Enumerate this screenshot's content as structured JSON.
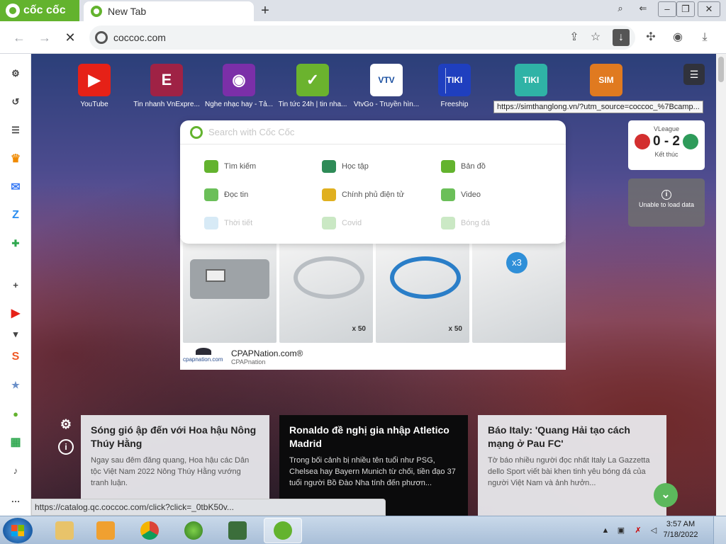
{
  "browser": {
    "brand": "cốc cốc",
    "tab_title": "New Tab",
    "new_tab_symbol": "+",
    "address": "coccoc.com"
  },
  "speed_dial": [
    {
      "label": "YouTube",
      "icon": "youtube-icon",
      "color": "#e62117",
      "glyph": "▶"
    },
    {
      "label": "Tin nhanh VnExpre...",
      "icon": "vnexpress-icon",
      "color": "#9f2245",
      "glyph": "E"
    },
    {
      "label": "Nghe nhạc hay - Tả...",
      "icon": "music-icon",
      "color": "#7b2fa8",
      "glyph": "◉"
    },
    {
      "label": "Tin tức 24h | tin nha...",
      "icon": "news24h-icon",
      "color": "#6bb32e",
      "glyph": "✓"
    },
    {
      "label": "VtvGo - Truyền hìn...",
      "icon": "vtvgo-icon",
      "color": "#ffffff",
      "glyph": "VTV"
    },
    {
      "label": "Freeship",
      "icon": "tiki-icon",
      "color": "#1f3fbf",
      "glyph": "TIKI"
    },
    {
      "label": "",
      "icon": "tiki-book-icon",
      "color": "#2fb3a6",
      "glyph": "TIKI"
    },
    {
      "label": "",
      "icon": "simthanglong-icon",
      "color": "#e07a20",
      "glyph": "SIM"
    }
  ],
  "tooltip": "https://simthanglong.vn/?utm_source=coccoc_%7Bcamp...",
  "search": {
    "placeholder": "Search with Cốc Cốc",
    "services": [
      {
        "label": "Tìm kiếm",
        "icon": "search-service-icon",
        "color": "#63b32e"
      },
      {
        "label": "Học tập",
        "icon": "graduation-cap-icon",
        "color": "#2e8b57"
      },
      {
        "label": "Bản đồ",
        "icon": "map-pin-icon",
        "color": "#63b32e"
      },
      {
        "label": "Đọc tin",
        "icon": "newspaper-icon",
        "color": "#6bbf59"
      },
      {
        "label": "Chính phủ điện tử",
        "icon": "government-icon",
        "color": "#e0b020"
      },
      {
        "label": "Video",
        "icon": "video-icon",
        "color": "#6bbf59"
      },
      {
        "label": "Thời tiết",
        "icon": "weather-icon",
        "color": "#8ec6e8"
      },
      {
        "label": "Covid",
        "icon": "covid-icon",
        "color": "#6bbf59"
      },
      {
        "label": "Bóng đá",
        "icon": "football-icon",
        "color": "#6bbf59"
      }
    ]
  },
  "ad": {
    "title": "CPAPNation.com®",
    "subtitle": "CPAPnation",
    "logo_text": "cpapnation.com",
    "qty_1": "x 50",
    "qty_2": "x 50",
    "badge": "x3"
  },
  "score": {
    "league": "VLeague",
    "score": "0 - 2",
    "status": "Kết thúc"
  },
  "data_card": {
    "message": "Unable to load data"
  },
  "news": [
    {
      "title": "Sóng gió ập đến với Hoa hậu Nông Thúy Hằng",
      "summary": "Ngay sau đêm đăng quang, Hoa hậu các Dân tộc Việt Nam 2022 Nông Thúy Hằng vướng tranh luận."
    },
    {
      "title": "Ronaldo đề nghị gia nhập Atletico Madrid",
      "summary": "Trong bối cảnh bị nhiều tên tuổi như PSG, Chelsea hay Bayern Munich từ chối, tiền đạo 37 tuổi người Bồ Đào Nha tính đến phươn..."
    },
    {
      "title": "Báo Italy: 'Quang Hải tạo cách mạng ở Pau FC'",
      "summary": "Tờ báo nhiều người đọc nhất Italy La Gazzetta dello Sport viết bài khen tinh yêu bóng đá của người Việt Nam và ảnh hưởn..."
    }
  ],
  "status_url": "https://catalog.qc.coccoc.com/click?click=_0tbK50v...",
  "sidebar": [
    {
      "name": "settings-gear-icon",
      "glyph": "⚙",
      "color": "#444"
    },
    {
      "name": "history-icon",
      "glyph": "↺",
      "color": "#444"
    },
    {
      "name": "reading-list-icon",
      "glyph": "☰",
      "color": "#444"
    },
    {
      "name": "crown-icon",
      "glyph": "♛",
      "color": "#f08a00"
    },
    {
      "name": "messenger-icon",
      "glyph": "✉",
      "color": "#3b7cf5"
    },
    {
      "name": "zalo-icon",
      "glyph": "Z",
      "color": "#2b8ef0"
    },
    {
      "name": "game-controller-icon",
      "glyph": "✚",
      "color": "#2fa84f"
    },
    {
      "name": "add-shortcut-icon",
      "glyph": "+",
      "color": "#444"
    },
    {
      "name": "youtube-sidebar-icon",
      "glyph": "▶",
      "color": "#e62117"
    },
    {
      "name": "chevron-down-icon",
      "glyph": "▾",
      "color": "#444"
    },
    {
      "name": "shopee-icon",
      "glyph": "S",
      "color": "#f05a28"
    },
    {
      "name": "anime-icon",
      "glyph": "★",
      "color": "#6a8fc8"
    },
    {
      "name": "coccoc-map-icon",
      "glyph": "●",
      "color": "#63b32e"
    },
    {
      "name": "sheet-icon",
      "glyph": "▦",
      "color": "#2fa84f"
    },
    {
      "name": "bell-icon",
      "glyph": "♪",
      "color": "#444"
    },
    {
      "name": "more-icon",
      "glyph": "…",
      "color": "#444"
    }
  ],
  "taskbar": {
    "time": "3:57 AM",
    "date": "7/18/2022"
  }
}
